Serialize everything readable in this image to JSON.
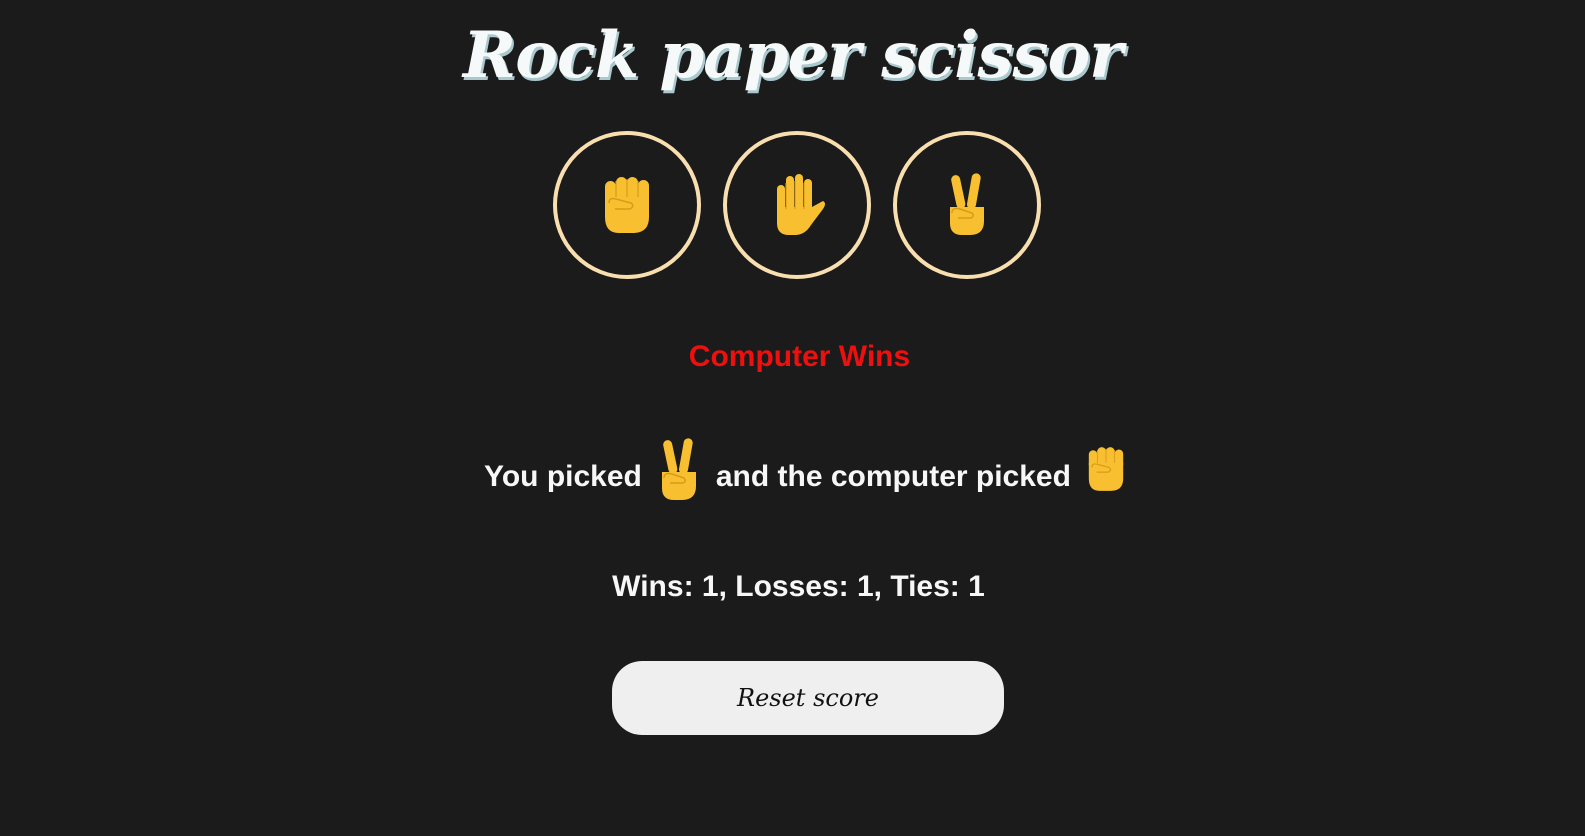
{
  "title": "Rock paper scissor",
  "choices": [
    {
      "name": "rock",
      "icon": "raised-fist-icon"
    },
    {
      "name": "paper",
      "icon": "raised-hand-icon"
    },
    {
      "name": "scissors",
      "icon": "victory-hand-icon"
    }
  ],
  "result": {
    "text": "Computer Wins",
    "color": "#ee0f0f"
  },
  "moves": {
    "prefix": "You picked",
    "middle": "and the computer picked",
    "player_move_icon": "victory-hand-icon",
    "computer_move_icon": "raised-fist-icon"
  },
  "score": {
    "text": "Wins: 1, Losses: 1, Ties: 1",
    "wins": 1,
    "losses": 1,
    "ties": 1
  },
  "reset_button": {
    "label": "Reset score"
  },
  "colors": {
    "background": "#1b1b1b",
    "circle_border": "#f9dfb0",
    "emoji_yellow": "#f8c030",
    "text": "#f7f7f7",
    "button_bg": "#efefef"
  }
}
